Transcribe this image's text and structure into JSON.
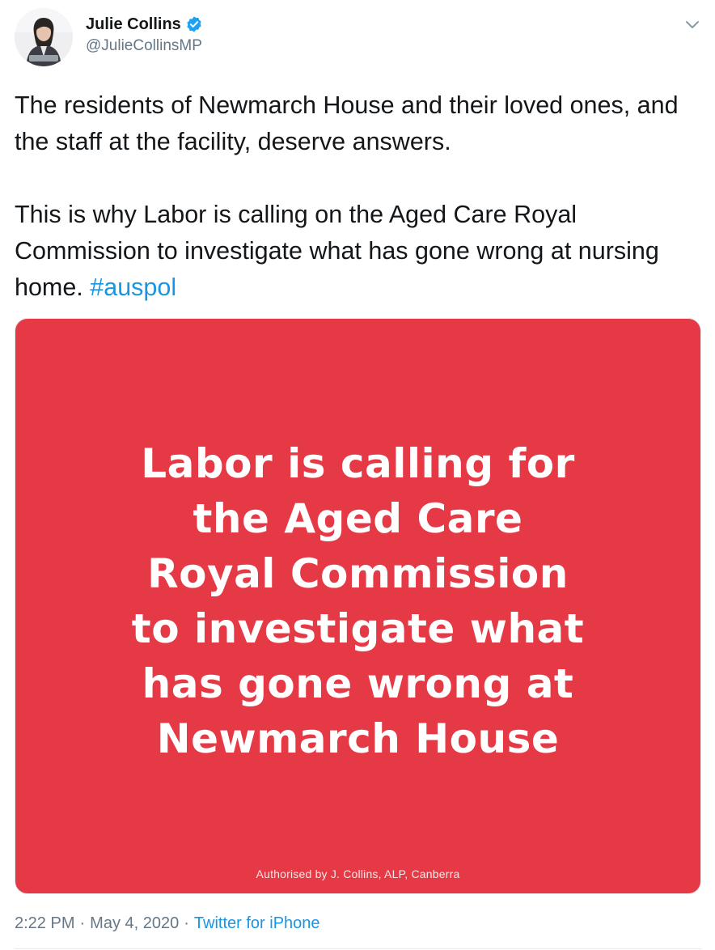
{
  "author": {
    "display_name": "Julie Collins",
    "handle": "@JulieCollinsMP",
    "verified_icon": "verified-badge-icon",
    "avatar_icon": "profile-photo"
  },
  "tweet": {
    "paragraph1": "The residents of Newmarch House and their loved ones, and the staff at the facility, deserve answers.",
    "paragraph2": "This is why Labor is calling on the Aged Care Royal Commission to investigate what has gone wrong at nursing home.",
    "hashtag": "#auspol"
  },
  "media": {
    "headline_lines": [
      "Labor is calling for",
      "the Aged Care",
      "Royal Commission",
      "to investigate what",
      "has gone wrong at",
      "Newmarch House"
    ],
    "authorisation": "Authorised by J. Collins, ALP, Canberra",
    "background_color": "#e63946"
  },
  "meta": {
    "time": "2:22 PM",
    "separator": "·",
    "date": "May 4, 2020",
    "source": "Twitter for iPhone"
  },
  "colors": {
    "link": "#1b95e0",
    "muted": "#657786",
    "text": "#14171a"
  }
}
